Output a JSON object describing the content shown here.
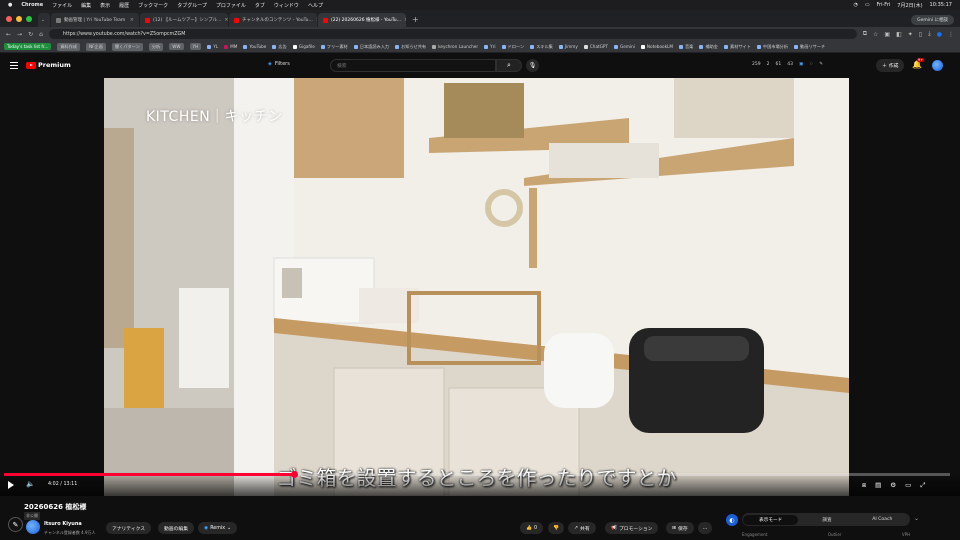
{
  "menubar": {
    "app": "Chrome",
    "menus": [
      "ファイル",
      "編集",
      "表示",
      "履歴",
      "ブックマーク",
      "タブグループ",
      "プロファイル",
      "タブ",
      "ウィンドウ",
      "ヘルプ"
    ],
    "right_status": [
      "Fri-Fri",
      "7月2日(木)",
      "10:35:17"
    ]
  },
  "tabs": [
    {
      "label": "動画管理 | Yri YouTube Team",
      "color": "#7a7a7a",
      "active": false
    },
    {
      "label": "(12) 【ルームツアー】シンプル...",
      "color": "#ff0000",
      "active": false
    },
    {
      "label": "チャンネルのコンテンツ - YouTu...",
      "color": "#ff0000",
      "active": false
    },
    {
      "label": "(22) 20260626 植松様 - YouTu...",
      "color": "#ff0000",
      "active": true
    }
  ],
  "browser": {
    "new_tab": "+",
    "gemini_label": "Gemini に相談",
    "url": "https://www.youtube.com/watch?v=Z5ompcmZGM"
  },
  "bookmarks": [
    {
      "label": "Today's task list fr...",
      "style": "tag"
    },
    {
      "label": "資料作成",
      "style": "tag2"
    },
    {
      "label": "NF企画",
      "style": "tag2"
    },
    {
      "label": "聞くパターン",
      "style": "tag2"
    },
    {
      "label": "分析",
      "style": "tag2"
    },
    {
      "label": "WW",
      "style": "tag2"
    },
    {
      "label": "YH",
      "style": "tag2"
    },
    {
      "label": "YL",
      "style": "plain"
    },
    {
      "label": "MM",
      "style": "plain"
    },
    {
      "label": "YouTube",
      "style": "plain"
    },
    {
      "label": "広告",
      "style": "plain"
    },
    {
      "label": "Gigafile",
      "style": "plain"
    },
    {
      "label": "フリー素材",
      "style": "plain"
    },
    {
      "label": "日本語読み入力",
      "style": "plain"
    },
    {
      "label": "お知らせ共有",
      "style": "plain"
    },
    {
      "label": "keychron Launcher",
      "style": "plain"
    },
    {
      "label": "Yri",
      "style": "plain"
    },
    {
      "label": "ドローン",
      "style": "plain"
    },
    {
      "label": "スキル集",
      "style": "plain"
    },
    {
      "label": "Jimmy",
      "style": "plain"
    },
    {
      "label": "ChatGPT",
      "style": "plain"
    },
    {
      "label": "Gemini",
      "style": "plain"
    },
    {
      "label": "NotebookLM",
      "style": "plain"
    },
    {
      "label": "音楽",
      "style": "plain"
    },
    {
      "label": "補助金",
      "style": "plain"
    },
    {
      "label": "素材サイト",
      "style": "plain"
    },
    {
      "label": "中国市場分析",
      "style": "plain"
    },
    {
      "label": "動画リサーチ",
      "style": "plain"
    }
  ],
  "youtube": {
    "logo_text": "Premium",
    "filters_label": "Filters",
    "search_placeholder": "検索",
    "stats": [
      "259",
      "2",
      "61",
      "43"
    ],
    "create_label": "作成",
    "notification_count": "9+"
  },
  "video": {
    "overlay_title": "KITCHEN｜キッチン",
    "subtitle": "ゴミ箱を設置するところを作ったりですとか",
    "time": "4:02 / 13:11",
    "progress": 0.3063
  },
  "below": {
    "title": "20260626 植松様",
    "visibility_badge": "非公開",
    "channel_name": "Itsuro Kiyuna",
    "channel_subs": "チャンネル登録者数 4.9万人",
    "analytics": "アナリティクス",
    "edit": "動画の編集",
    "remix": "Remix",
    "likes": "0",
    "share": "共有",
    "promotion": "プロモーション",
    "save": "保存",
    "panel_tabs": [
      "表示モード",
      "調査",
      "AI Coach"
    ],
    "panel_sublabels": [
      "Engagement",
      "Outlier",
      "VPH"
    ]
  }
}
